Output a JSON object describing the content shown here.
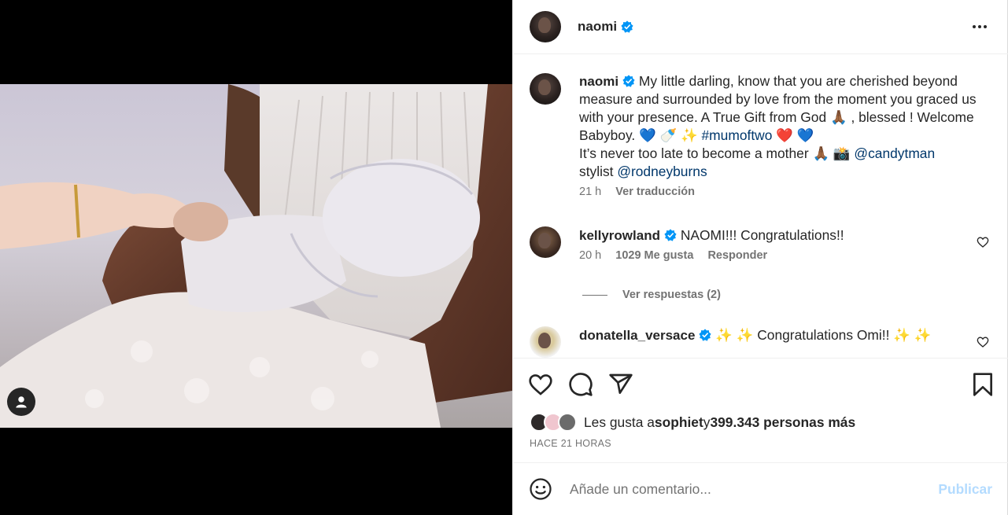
{
  "post": {
    "author": "naomi",
    "author_verified": true
  },
  "caption": {
    "handle": "naomi",
    "text_1": " My little darling, know that you are cherished beyond measure and surrounded by love from the moment you graced us with your presence. A True Gift from God 🙏🏾 , blessed ! Welcome Babyboy. 💙 🍼 ✨ ",
    "hashtag": "#mumoftwo",
    "text_2": " ❤️ 💙",
    "text_3": "It’s never too late to become a mother 🙏🏾 📸 ",
    "mention_1": "@candytman",
    "text_4": "stylist ",
    "mention_2": "@rodneyburns",
    "age": "21 h",
    "translate": "Ver traducción"
  },
  "comments": [
    {
      "handle": "kellyrowland",
      "verified": true,
      "text": " NAOMI!!! Congratulations!!",
      "age": "20 h",
      "likes": "1029 Me gusta",
      "reply": "Responder",
      "view_replies": "Ver respuestas (2)"
    },
    {
      "handle": "donatella_versace",
      "verified": true,
      "text": " ✨ ✨  Congratulations Omi!! ✨ ✨"
    }
  ],
  "likes": {
    "prefix": "Les gusta a ",
    "user": "sophiet",
    "middle": " y ",
    "count": "399.343 personas más"
  },
  "timestamp": "HACE 21 HORAS",
  "composer": {
    "placeholder": "Añade un comentario...",
    "publish": "Publicar"
  },
  "colors": {
    "verified_blue": "#0095f6",
    "link": "#00376b",
    "publish_disabled": "#b3dbff"
  },
  "icons": [
    "user-tag-icon",
    "more-icon",
    "heart-icon",
    "comment-icon",
    "share-icon",
    "bookmark-icon",
    "emoji-icon",
    "verified-icon"
  ]
}
